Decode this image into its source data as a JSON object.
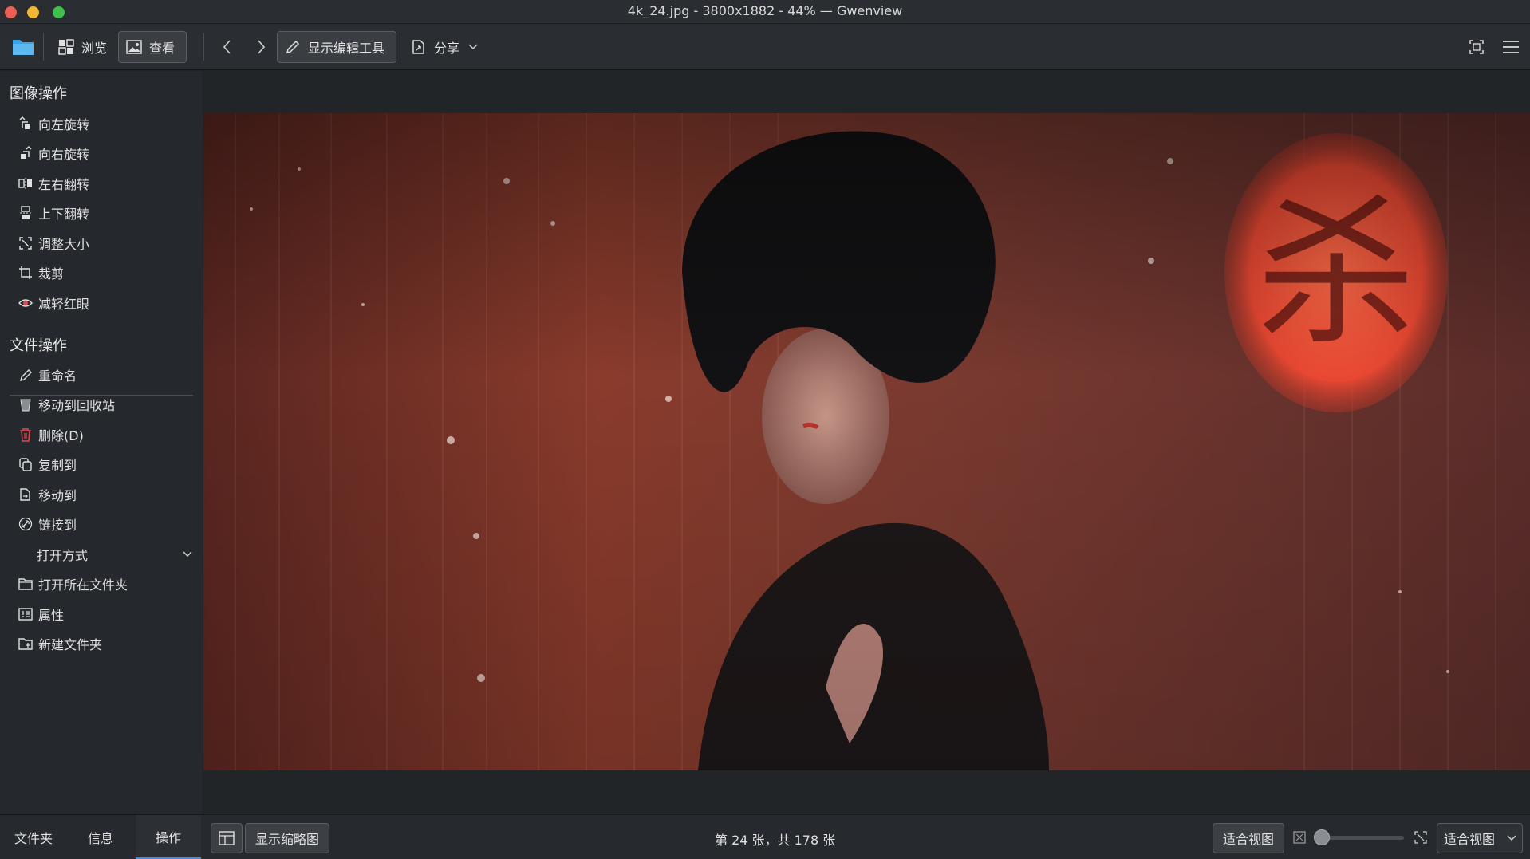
{
  "window": {
    "title": "4k_24.jpg - 3800x1882 - 44% — Gwenview"
  },
  "toolbar": {
    "browse_label": "浏览",
    "view_label": "查看",
    "show_editor_label": "显示编辑工具",
    "share_label": "分享"
  },
  "sidebar": {
    "image_ops_title": "图像操作",
    "image_ops": [
      {
        "label": "向左旋转",
        "icon": "rotate-left-icon"
      },
      {
        "label": "向右旋转",
        "icon": "rotate-right-icon"
      },
      {
        "label": "左右翻转",
        "icon": "flip-horizontal-icon"
      },
      {
        "label": "上下翻转",
        "icon": "flip-vertical-icon"
      },
      {
        "label": "调整大小",
        "icon": "resize-icon"
      },
      {
        "label": "裁剪",
        "icon": "crop-icon"
      },
      {
        "label": "减轻红眼",
        "icon": "red-eye-icon"
      }
    ],
    "file_ops_title": "文件操作",
    "file_ops": [
      {
        "label": "重命名",
        "icon": "rename-icon"
      },
      {
        "label": "移动到回收站",
        "icon": "trash-icon"
      },
      {
        "label": "删除(D)",
        "icon": "delete-icon"
      },
      {
        "label": "复制到",
        "icon": "copy-icon"
      },
      {
        "label": "移动到",
        "icon": "move-icon"
      },
      {
        "label": "链接到",
        "icon": "link-icon"
      },
      {
        "label": "打开方式",
        "icon": "chevron-down-icon"
      },
      {
        "label": "打开所在文件夹",
        "icon": "folder-icon"
      },
      {
        "label": "属性",
        "icon": "properties-icon"
      },
      {
        "label": "新建文件夹",
        "icon": "new-folder-icon"
      }
    ]
  },
  "image": {
    "lantern_char": "杀"
  },
  "statusbar": {
    "tabs": [
      "文件夹",
      "信息",
      "操作"
    ],
    "active_tab": "操作",
    "show_thumbnails_label": "显示缩略图",
    "position_text": "第 24 张，共 178 张",
    "fit_view_button": "适合视图",
    "zoom_select_value": "适合视图",
    "zoom_slider_fraction": 0
  },
  "colors": {
    "accent": "#3d8ef0",
    "folder_icon": "#3ba3e8",
    "delete_icon": "#e0484e"
  }
}
